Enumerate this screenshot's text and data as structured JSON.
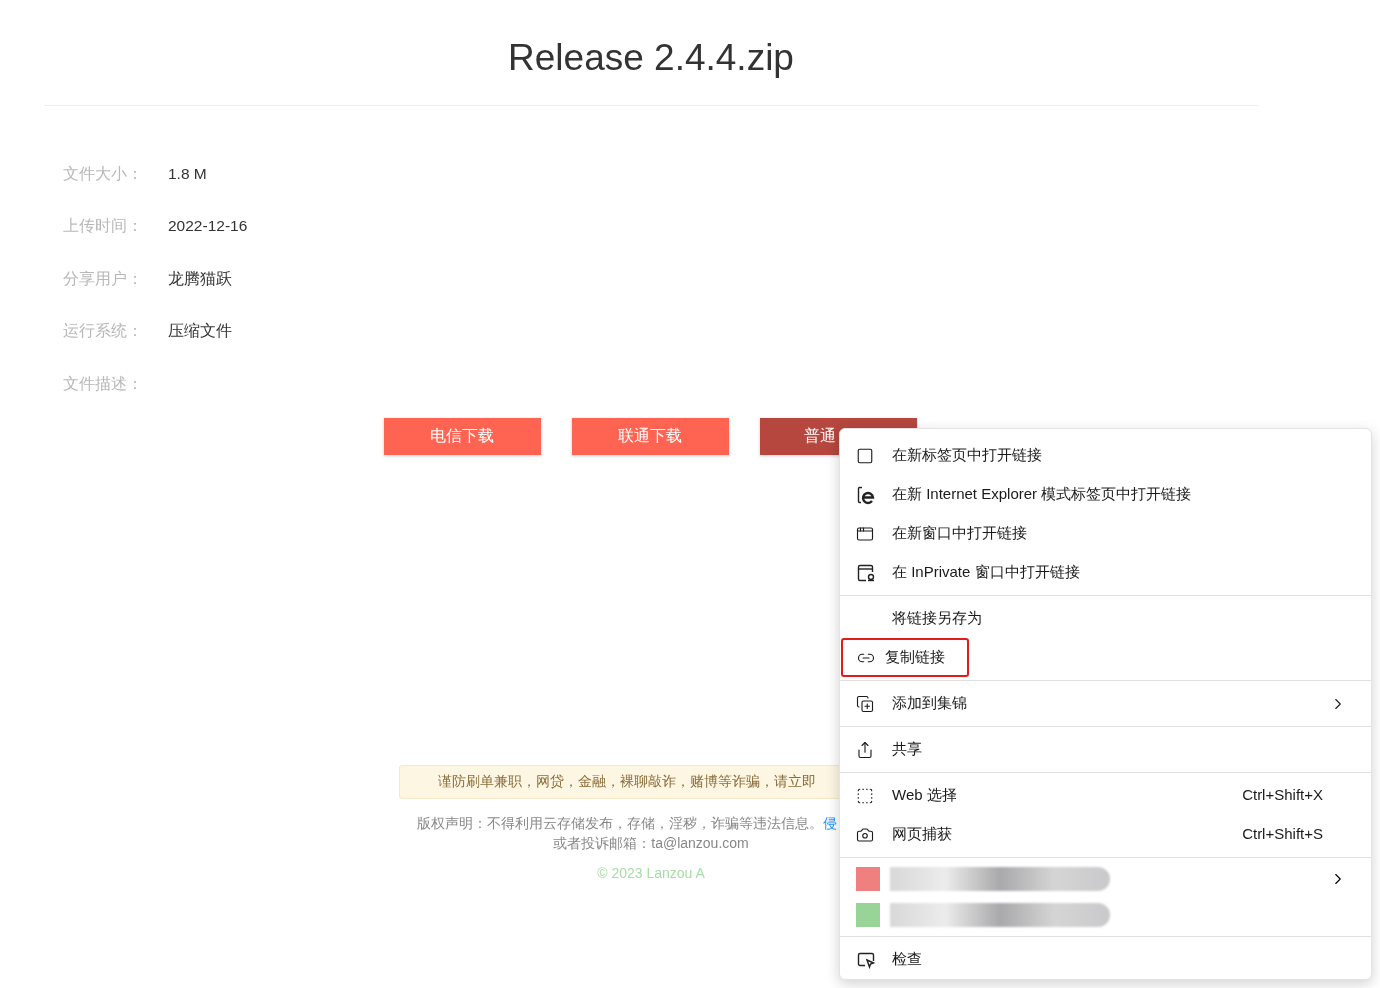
{
  "title": "Release 2.4.4.zip",
  "info": [
    {
      "label": "文件大小：",
      "value": "1.8 M"
    },
    {
      "label": "上传时间：",
      "value": "2022-12-16"
    },
    {
      "label": "分享用户：",
      "value": "龙腾猫跃"
    },
    {
      "label": "运行系统：",
      "value": "压缩文件"
    },
    {
      "label": "文件描述："
    }
  ],
  "buttons": [
    {
      "label": "电信下载",
      "hovered": false
    },
    {
      "label": "联通下载",
      "hovered": false
    },
    {
      "label": "普通",
      "hovered": true
    }
  ],
  "warning": "谨防刷单兼职，网贷，金融，裸聊敲诈，赌博等诈骗，请立即",
  "copyright": {
    "text": "版权声明：不得利用云存储发布，存储，淫秽，诈骗等违法信息。",
    "link": "侵",
    "email": "或者投诉邮箱：ta@lanzou.com"
  },
  "footer": "© 2023 Lanzou A",
  "context_menu": {
    "groups": [
      [
        {
          "kind": "item",
          "label": "在新标签页中打开链接",
          "highlighted": false
        },
        {
          "kind": "item",
          "label": "在新 Internet Explorer 模式标签页中打开链接",
          "highlighted": false
        },
        {
          "kind": "item",
          "label": "在新窗口中打开链接",
          "highlighted": false
        },
        {
          "kind": "item",
          "label": "在 InPrivate 窗口中打开链接",
          "highlighted": false
        }
      ],
      [
        {
          "kind": "item",
          "label": "将链接另存为",
          "highlighted": false
        },
        {
          "kind": "item",
          "label": "复制链接",
          "highlighted": true
        }
      ],
      [
        {
          "kind": "item",
          "label": "添加到集锦",
          "highlighted": false,
          "submenu": true
        }
      ],
      [
        {
          "kind": "item",
          "label": "共享",
          "highlighted": false
        }
      ],
      [
        {
          "kind": "item",
          "label": "Web 选择",
          "shortcut": "Ctrl+Shift+X",
          "highlighted": false
        },
        {
          "kind": "item",
          "label": "网页捕获",
          "shortcut": "Ctrl+Shift+S",
          "highlighted": false
        }
      ],
      [
        {
          "kind": "redacted",
          "color": "#f08080",
          "submenu": true
        },
        {
          "kind": "redacted",
          "color": "#98d498"
        }
      ],
      [
        {
          "kind": "item",
          "label": "检查",
          "highlighted": false
        }
      ]
    ]
  }
}
